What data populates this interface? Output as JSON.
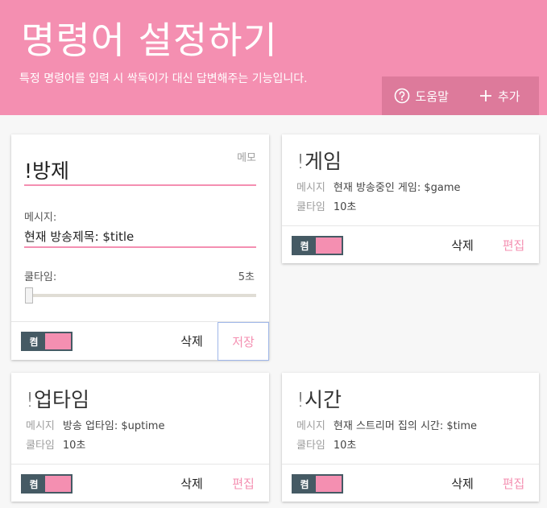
{
  "header": {
    "title": "명령어 설정하기",
    "subtitle": "특정 명령어를 입력 시 싹둑이가 대신 답변해주는 기능입니다.",
    "help_label": "도움말",
    "add_label": "추가"
  },
  "editor": {
    "memo_label": "메모",
    "command": "!방제",
    "message_label": "메시지:",
    "message_value": "현재 방송제목: $title",
    "cooldown_label": "쿨타임:",
    "cooldown_value": "5초",
    "toggle_label": "켬",
    "delete_label": "삭제",
    "save_label": "저장"
  },
  "labels": {
    "message": "메시지",
    "cooldown": "쿨타임",
    "toggle": "켬",
    "delete": "삭제",
    "edit": "편집"
  },
  "commands": [
    {
      "command": "!게임",
      "message": "현재 방송중인 게임: $game",
      "cooldown": "10초"
    },
    {
      "command": "!업타임",
      "message": "방송 업타임: $uptime",
      "cooldown": "10초"
    },
    {
      "command": "!시간",
      "message": "현재 스트리머 집의 시간: $time",
      "cooldown": "10초"
    }
  ],
  "colors": {
    "accent": "#f48fb1",
    "header_button_bg": "#dd7a9b",
    "toggle_dark": "#455a64"
  },
  "icons": {
    "help": "question-circle-icon",
    "add": "plus-icon"
  }
}
